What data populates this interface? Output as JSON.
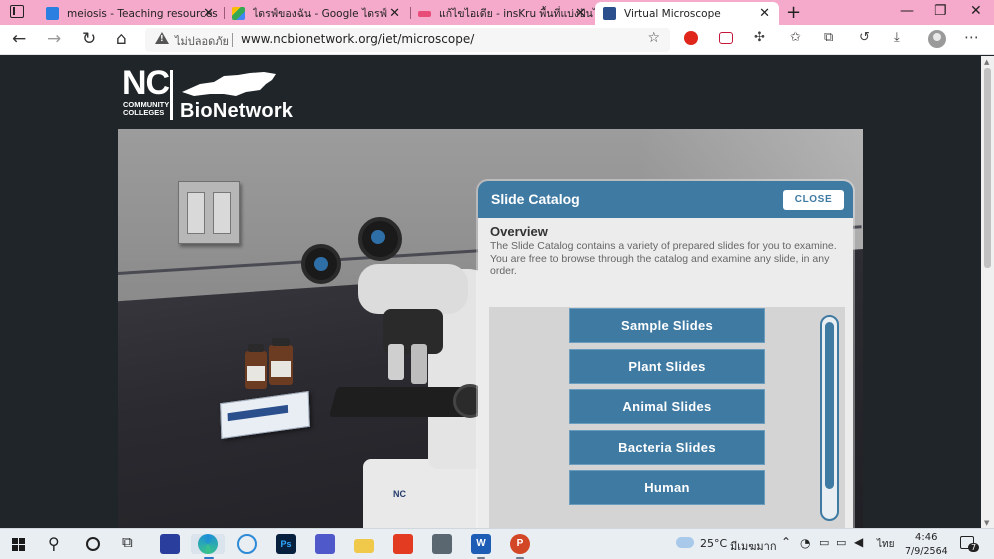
{
  "browser": {
    "tabs": [
      {
        "title": "meiosis - Teaching resources",
        "close": "✕",
        "active": false,
        "favicon_color": "#2a7fe0"
      },
      {
        "title": "ไดรฟ์ของฉัน - Google ไดรฟ์",
        "close": "✕",
        "active": false,
        "favicon_color": "#34a853"
      },
      {
        "title": "แก้ไขไอเดีย - insKru พื้นที่แบ่งปันไอเดียการสอน",
        "close": "✕",
        "active": false,
        "favicon_color": "#e84d7a"
      },
      {
        "title": "Virtual Microscope",
        "close": "✕",
        "active": true,
        "favicon_color": "#2b4e8c"
      }
    ],
    "new_tab": "+",
    "window_controls": {
      "minimize": "—",
      "restore": "❐",
      "close": "✕"
    },
    "address": {
      "security_label": "ไม่ปลอดภัย",
      "url": "www.ncbionetwork.org/iet/microscope/"
    }
  },
  "page": {
    "logo": {
      "nc": "NC",
      "community_colleges": "COMMUNITY\nCOLLEGES",
      "bionetwork": "BioNetwork"
    },
    "microscope_badge": "NC",
    "slide_catalog": {
      "title": "Slide Catalog",
      "close_label": "CLOSE",
      "overview_heading": "Overview",
      "overview_text": "The Slide Catalog contains a variety of prepared slides for you to examine. You are free to browse through the catalog and examine any slide, in any order.",
      "categories": [
        "Sample Slides",
        "Plant Slides",
        "Animal Slides",
        "Bacteria Slides",
        "Human"
      ],
      "accent": "#3f7aa3"
    }
  },
  "taskbar": {
    "weather": {
      "temp": "25°C",
      "condition": "มีเมฆมาก"
    },
    "language": "ไทย",
    "time": "4:46",
    "date": "7/9/2564",
    "notification_count": "7"
  }
}
